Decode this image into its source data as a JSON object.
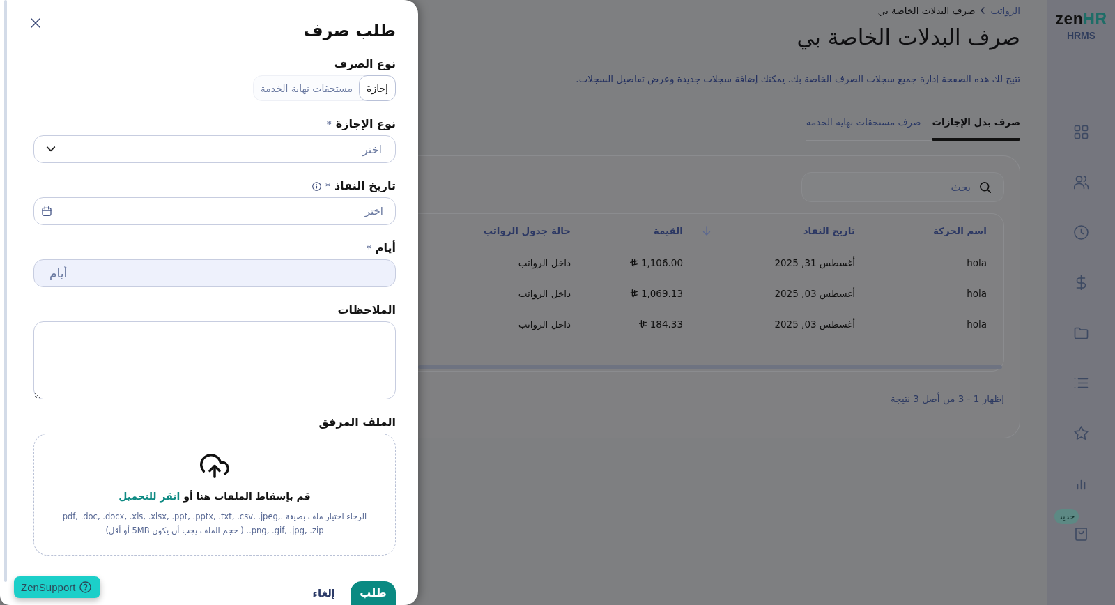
{
  "drawer": {
    "title": "طلب صرف",
    "fields": [
      {
        "kind": "segmented",
        "label": "نوع الصرف",
        "options": [
          {
            "label": "إجازة",
            "selected": true
          },
          {
            "label": "مستحقات نهاية الخدمة",
            "selected": false
          }
        ]
      },
      {
        "kind": "select",
        "label": "نوع الإجازة",
        "required_mark": "*",
        "placeholder": "اختر"
      },
      {
        "kind": "date",
        "label": "تاريخ النفاذ",
        "required_mark": "*",
        "info_icon": true,
        "placeholder": "اختر"
      },
      {
        "kind": "number",
        "label": "أيام",
        "required_mark": "*",
        "placeholder": "أيام"
      },
      {
        "kind": "textarea",
        "label": "الملاحظات"
      },
      {
        "kind": "upload",
        "label": "الملف المرفق",
        "prompt": "قم بإسقاط الملفات هنا أو",
        "link": "انقر للتحميل",
        "hint": "الرجاء اختيار ملف بصيغة .pdf, .doc, .docx, .xls, .xlsx, .ppt, .pptx, .txt, .csv, .jpeg, .png, .gif, .jpg, .zip. ( حجم الملف يجب أن يكون 5MB أو أقل)"
      }
    ],
    "buttons": [
      {
        "kind": "primary",
        "label": "طلب"
      },
      {
        "kind": "text",
        "label": "إلغاء"
      }
    ]
  },
  "support_button": {
    "label": "ZenSupport"
  },
  "breadcrumb": [
    {
      "label": "الرواتب",
      "current": false
    },
    {
      "label": "صرف البدلات الخاصة بي",
      "current": true
    }
  ],
  "page": {
    "title": "صرف البدلات الخاصة بي",
    "description": "تتيح لك هذه الصفحة إدارة جميع سجلات الصرف الخاصة بك. يمكنك إضافة سجلات جديدة وعرض تفاصيل السجلات."
  },
  "tabs": [
    {
      "label": "صرف بدل الإجازات",
      "selected": true
    },
    {
      "label": "صرف مستحقات نهاية الخدمة",
      "selected": false
    }
  ],
  "search": {
    "placeholder": "بحث"
  },
  "table": {
    "columns": [
      {
        "label": "اسم الحركة",
        "kind": "text"
      },
      {
        "label": "تاريخ النفاذ",
        "kind": "text",
        "sort_icon": true
      },
      {
        "label": "القيمة",
        "kind": "currency"
      },
      {
        "label": "حالة جدول الرواتب",
        "kind": "text"
      }
    ],
    "rows": [
      {
        "cells": [
          "hola",
          "أغسطس 31, 2025",
          "1,106.00",
          "داخل الرواتب"
        ]
      },
      {
        "cells": [
          "hola",
          "أغسطس 03, 2025",
          "1,069.13",
          "داخل الرواتب"
        ]
      },
      {
        "cells": [
          "hola",
          "أغسطس 03, 2025",
          "184.33",
          "داخل الرواتب"
        ]
      }
    ]
  },
  "pagination": {
    "summary": "إظهار 1 - 3 من أصل 3 نتيجة"
  },
  "sidebar": {
    "brand": "zen",
    "brand_accent": "HR",
    "product": "HRMS",
    "new_badge": "جديد"
  }
}
